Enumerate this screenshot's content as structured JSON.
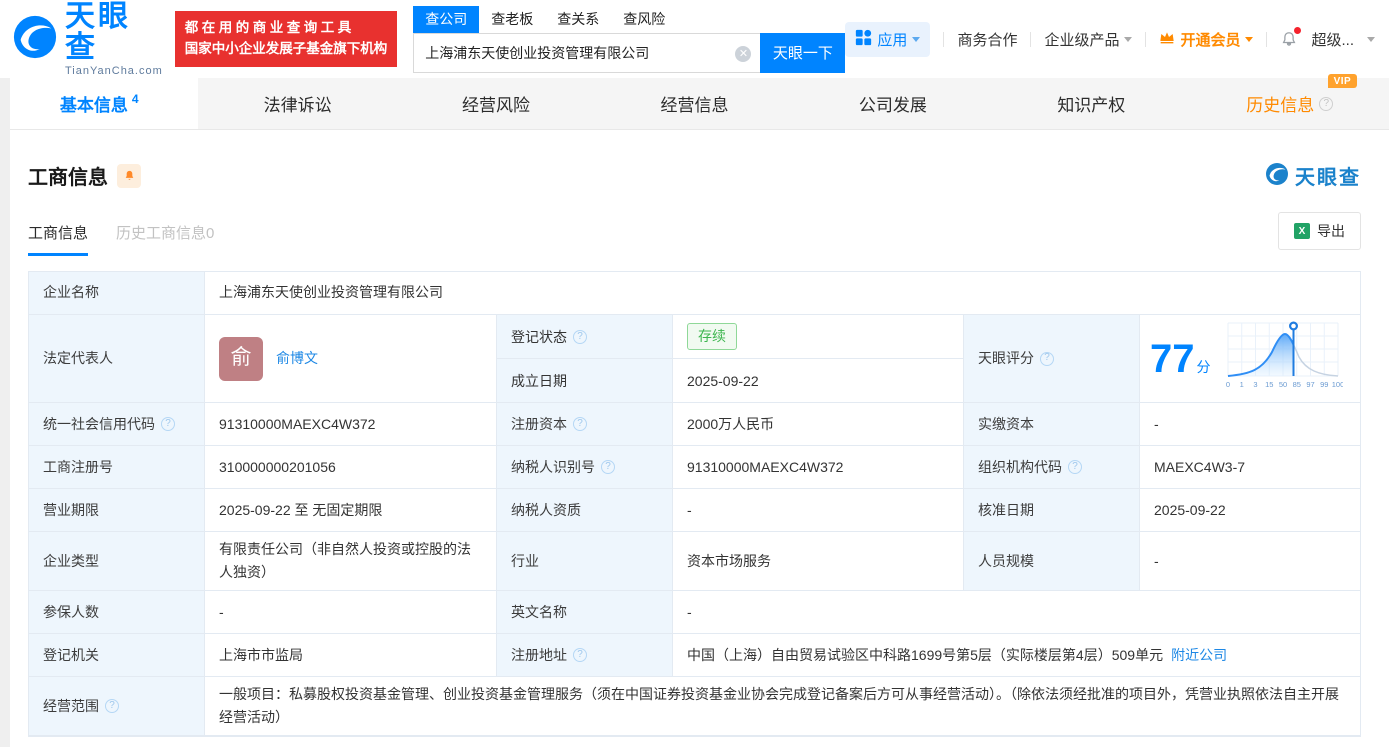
{
  "colors": {
    "primary": "#0084ff",
    "link": "#1e88e5",
    "orange": "#ff8a00",
    "banner_red": "#e8312f",
    "status_green": "#3eb650",
    "label_cell_bg": "#eef6fd",
    "avatar_bg": "#bf8084"
  },
  "header": {
    "brand": "天眼查",
    "brand_domain": "TianYanCha.com",
    "slogan_line1": "都在用的商业查询工具",
    "slogan_line2": "国家中小企业发展子基金旗下机构",
    "search_tabs": [
      {
        "label": "查公司"
      },
      {
        "label": "查老板"
      },
      {
        "label": "查关系"
      },
      {
        "label": "查风险"
      }
    ],
    "search_value": "上海浦东天使创业投资管理有限公司",
    "search_button": "天眼一下",
    "nav_apps": "应用",
    "nav_cooperation": "商务合作",
    "nav_enterprise": "企业级产品",
    "nav_vip": "开通会员",
    "nav_super": "超级..."
  },
  "nav_tabs": [
    {
      "label": "基本信息",
      "count": "4"
    },
    {
      "label": "法律诉讼"
    },
    {
      "label": "经营风险"
    },
    {
      "label": "经营信息"
    },
    {
      "label": "公司发展"
    },
    {
      "label": "知识产权"
    },
    {
      "label": "历史信息",
      "badge": "VIP"
    }
  ],
  "section": {
    "title": "工商信息",
    "watermark_brand": "天眼查",
    "subtab_active": "工商信息",
    "subtab_history": "历史工商信息0",
    "export_label": "导出"
  },
  "score": {
    "label": "天眼评分",
    "value": "77",
    "unit": "分",
    "axis_ticks": [
      "0",
      "1",
      "3",
      "15",
      "50",
      "85",
      "97",
      "99",
      "100"
    ]
  },
  "biz": {
    "company_name_label": "企业名称",
    "company_name": "上海浦东天使创业投资管理有限公司",
    "legal_rep_label": "法定代表人",
    "legal_rep_avatar_char": "俞",
    "legal_rep_name": "俞博文",
    "reg_status_label": "登记状态",
    "reg_status": "存续",
    "establish_date_label": "成立日期",
    "establish_date": "2025-09-22",
    "uscc_label": "统一社会信用代码",
    "uscc": "91310000MAEXC4W372",
    "reg_capital_label": "注册资本",
    "reg_capital": "2000万人民币",
    "paid_capital_label": "实缴资本",
    "paid_capital": "-",
    "reg_number_label": "工商注册号",
    "reg_number": "310000000201056",
    "taxpayer_id_label": "纳税人识别号",
    "taxpayer_id": "91310000MAEXC4W372",
    "org_code_label": "组织机构代码",
    "org_code": "MAEXC4W3-7",
    "business_term_label": "营业期限",
    "business_term": "2025-09-22 至 无固定期限",
    "taxpayer_quality_label": "纳税人资质",
    "taxpayer_quality": "-",
    "approval_date_label": "核准日期",
    "approval_date": "2025-09-22",
    "company_type_label": "企业类型",
    "company_type": "有限责任公司（非自然人投资或控股的法人独资）",
    "industry_label": "行业",
    "industry": "资本市场服务",
    "staff_size_label": "人员规模",
    "staff_size": "-",
    "insured_label": "参保人数",
    "insured": "-",
    "english_name_label": "英文名称",
    "english_name": "-",
    "reg_authority_label": "登记机关",
    "reg_authority": "上海市市监局",
    "reg_address_label": "注册地址",
    "reg_address": "中国（上海）自由贸易试验区中科路1699号第5层（实际楼层第4层）509单元",
    "nearby_link": "附近公司",
    "business_scope_label": "经营范围",
    "business_scope": "一般项目：私募股权投资基金管理、创业投资基金管理服务（须在中国证券投资基金业协会完成登记备案后方可从事经营活动）。（除依法须经批准的项目外，凭营业执照依法自主开展经营活动）"
  }
}
